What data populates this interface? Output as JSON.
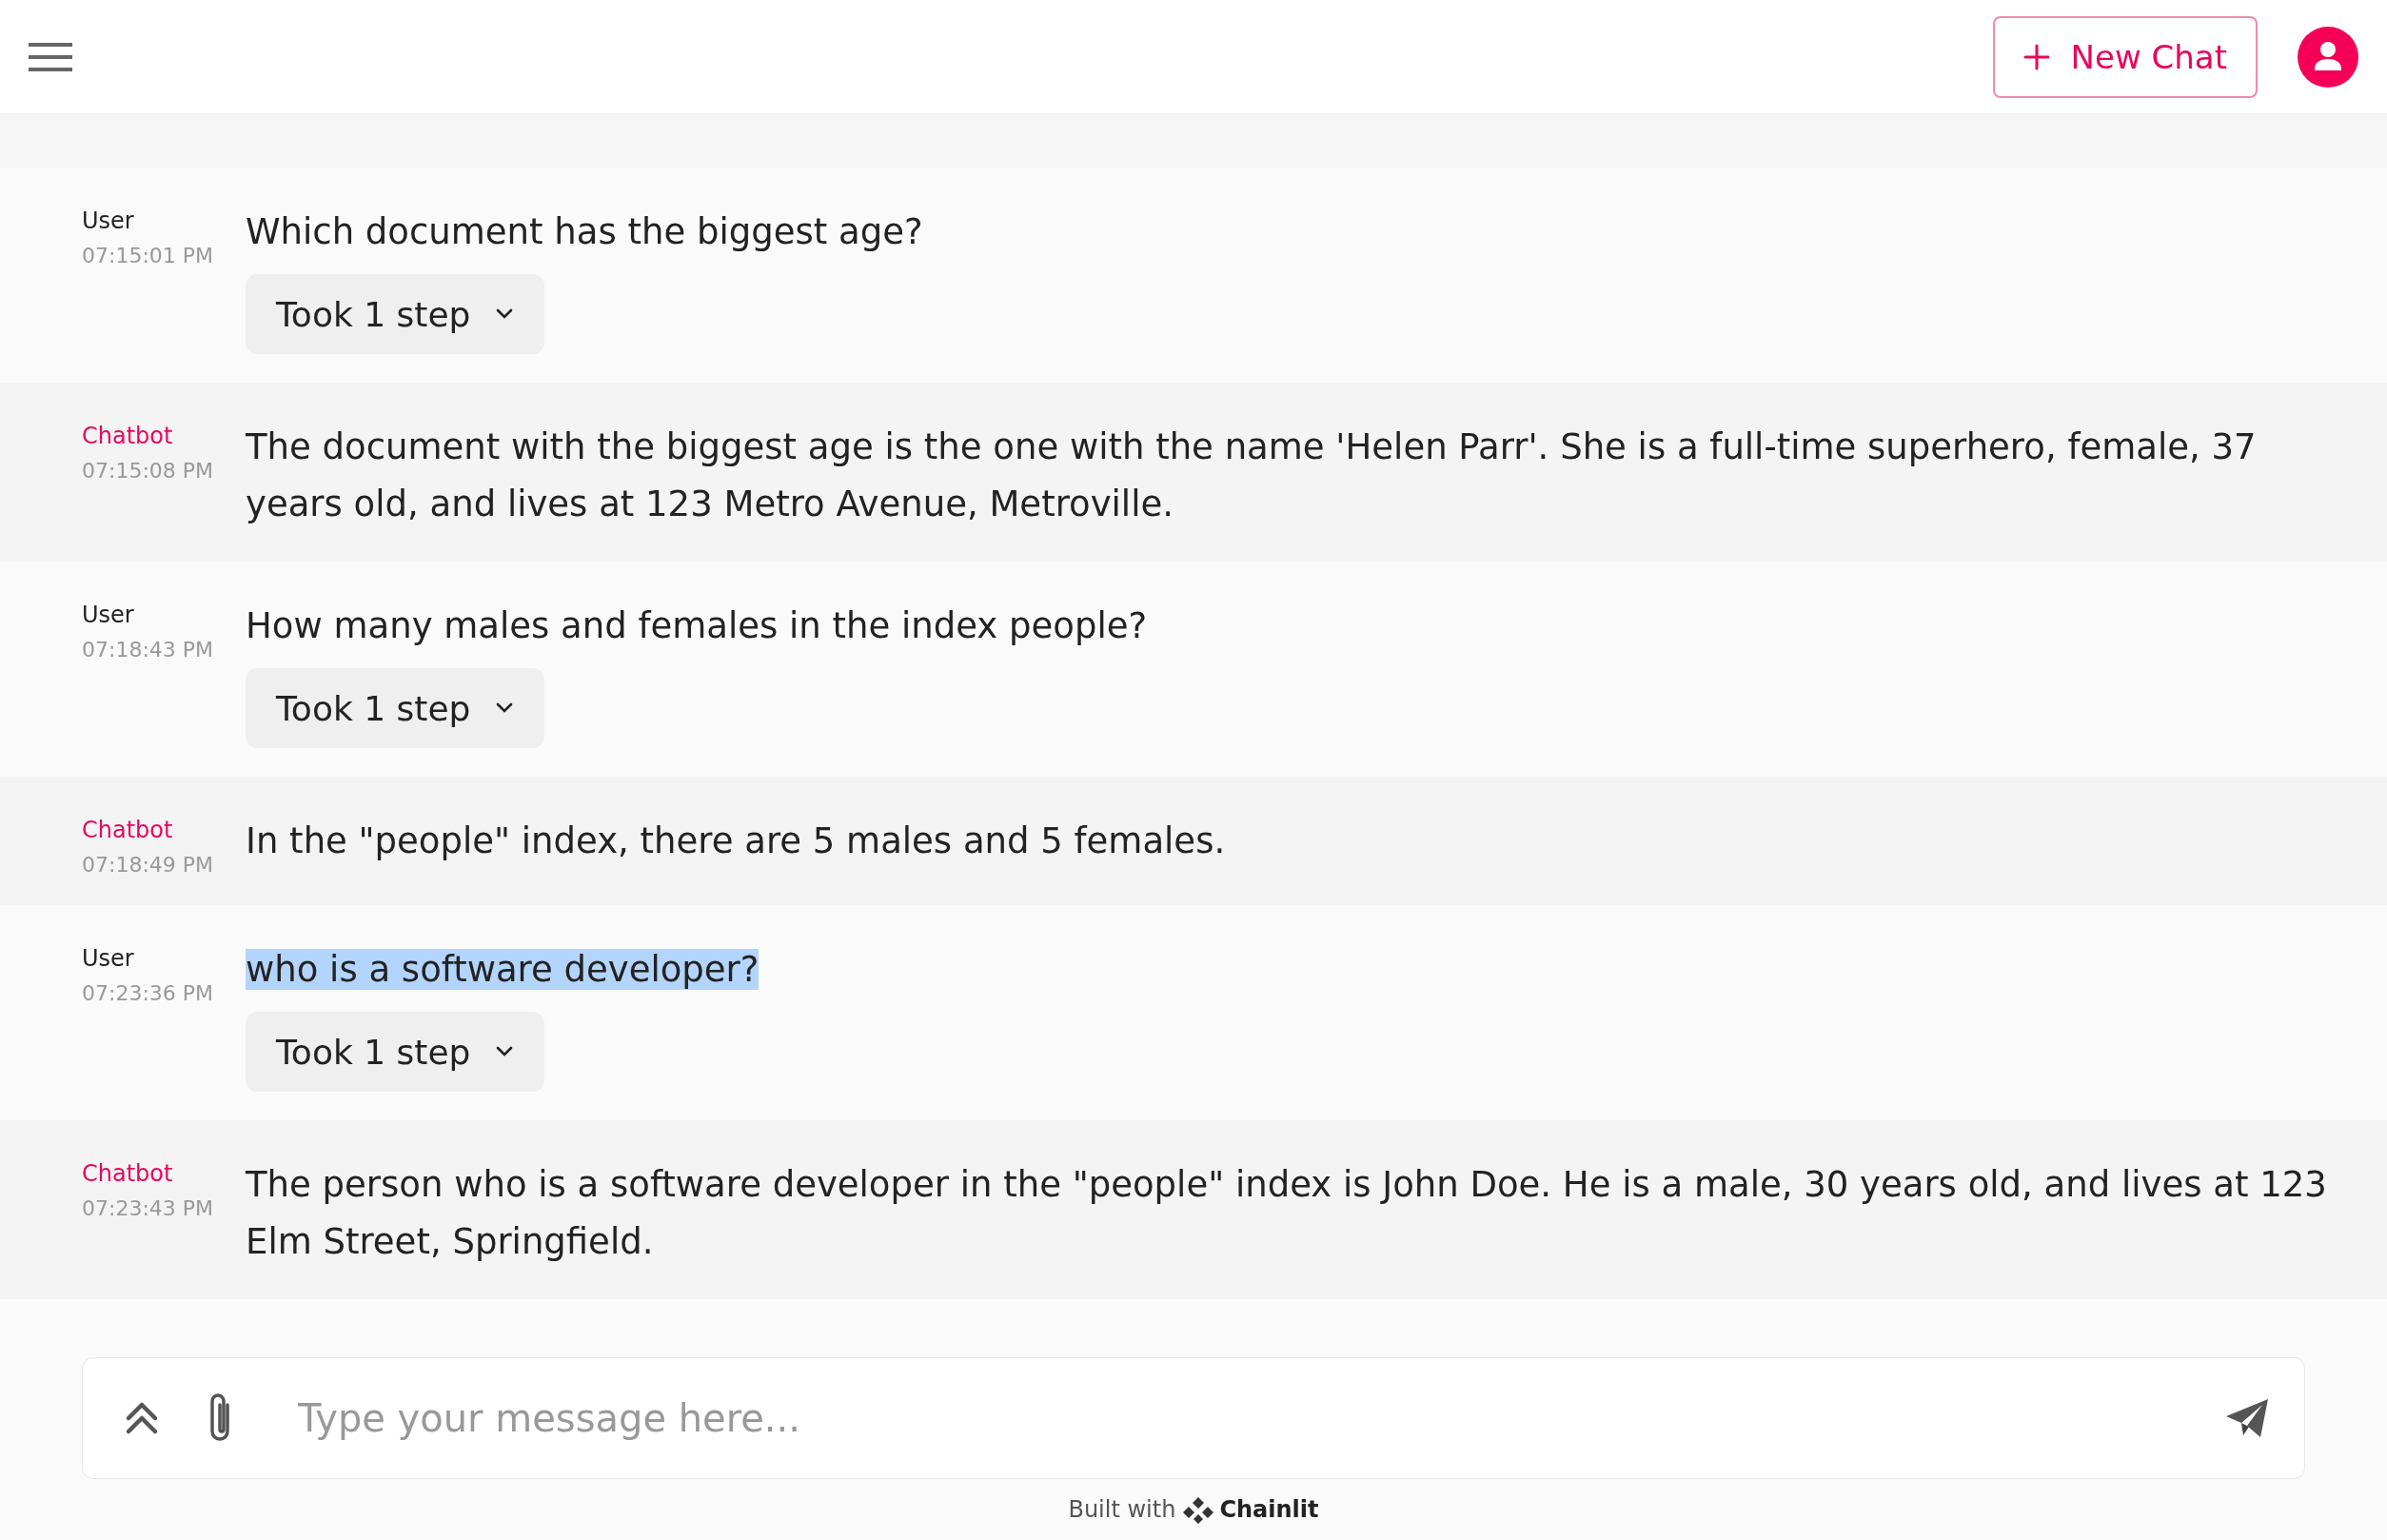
{
  "header": {
    "new_chat_button": "New Chat"
  },
  "messages": [
    {
      "kind": "user",
      "author": "User",
      "time": "07:15:01 PM",
      "text": "Which document has the biggest age?",
      "highlighted": false,
      "step": "Took 1 step"
    },
    {
      "kind": "bot",
      "author": "Chatbot",
      "time": "07:15:08 PM",
      "text": "The document with the biggest age is the one with the name 'Helen Parr'. She is a full-time superhero, female, 37 years old, and lives at 123 Metro Avenue, Metroville.",
      "highlighted": false
    },
    {
      "kind": "user",
      "author": "User",
      "time": "07:18:43 PM",
      "text": "How many males and females in the index people?",
      "highlighted": false,
      "step": "Took 1 step"
    },
    {
      "kind": "bot",
      "author": "Chatbot",
      "time": "07:18:49 PM",
      "text": "In the \"people\" index, there are 5 males and 5 females.",
      "highlighted": false
    },
    {
      "kind": "user",
      "author": "User",
      "time": "07:23:36 PM",
      "text": "who is a software developer?",
      "highlighted": true,
      "step": "Took 1 step"
    },
    {
      "kind": "bot",
      "author": "Chatbot",
      "time": "07:23:43 PM",
      "text": "The person who is a software developer in the \"people\" index is John Doe. He is a male, 30 years old, and lives at 123 Elm Street, Springfield.",
      "highlighted": false
    }
  ],
  "composer": {
    "placeholder": "Type your message here..."
  },
  "footer": {
    "built_with": "Built with",
    "brand": "Chainlit"
  }
}
